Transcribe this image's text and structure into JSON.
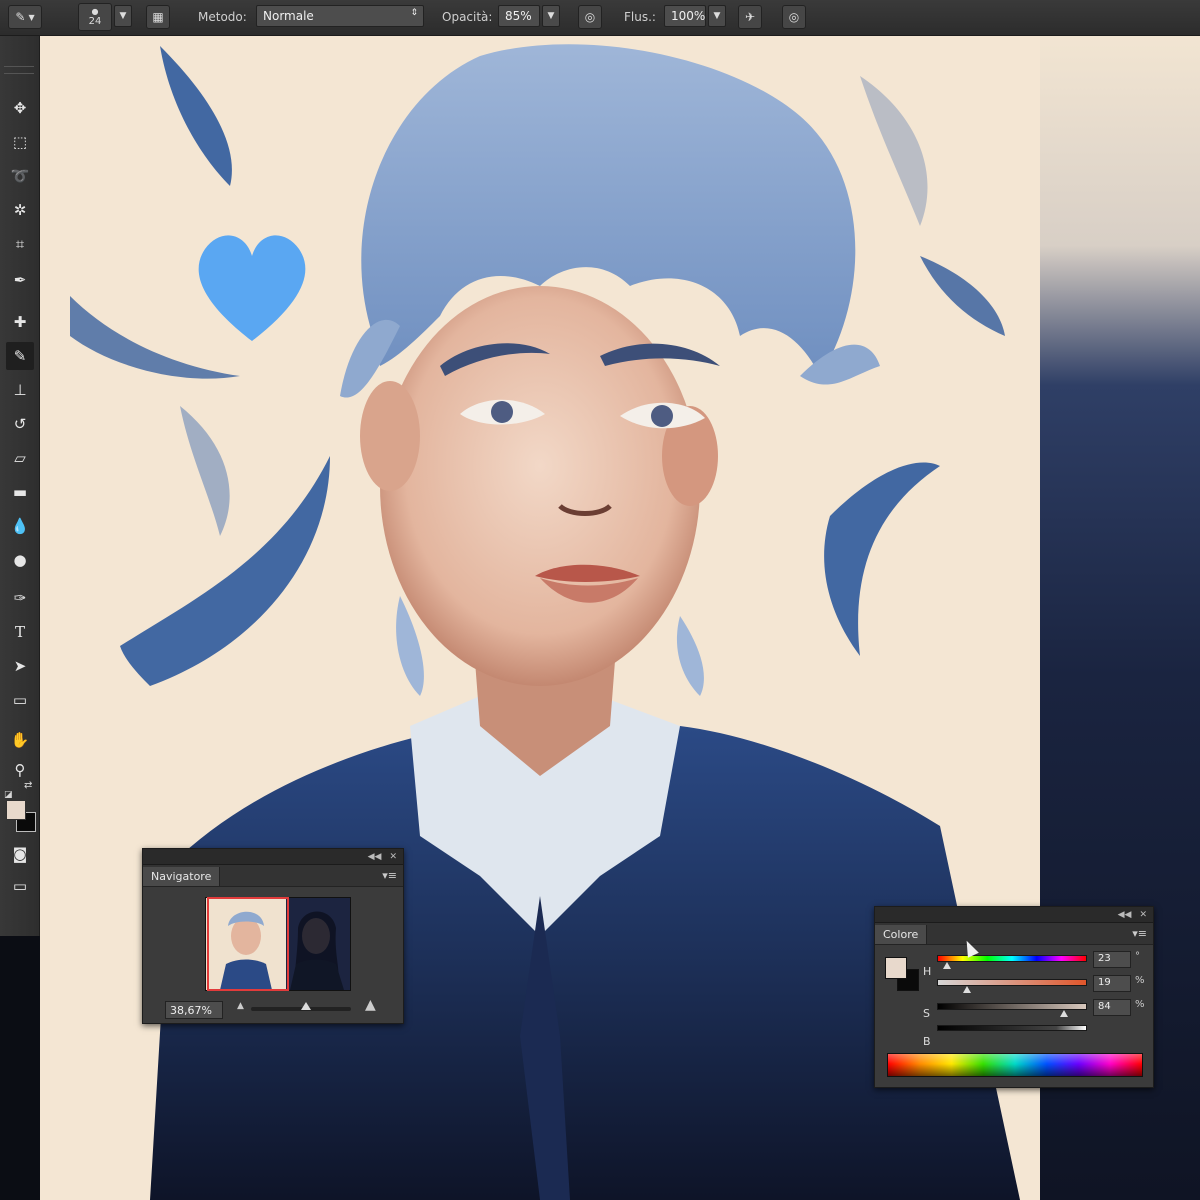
{
  "options_bar": {
    "brush_size": "24",
    "mode_label": "Metodo:",
    "mode_value": "Normale",
    "opacity_label": "Opacità:",
    "opacity_value": "85%",
    "flow_label": "Flus.:",
    "flow_value": "100%"
  },
  "tools": [
    {
      "icon": "move-icon"
    },
    {
      "icon": "marquee-icon"
    },
    {
      "icon": "lasso-icon"
    },
    {
      "icon": "magic-wand-icon"
    },
    {
      "icon": "crop-icon"
    },
    {
      "icon": "eyedropper-icon"
    },
    {
      "icon": "healing-brush-icon"
    },
    {
      "icon": "brush-icon",
      "active": true
    },
    {
      "icon": "clone-stamp-icon"
    },
    {
      "icon": "history-brush-icon"
    },
    {
      "icon": "eraser-icon"
    },
    {
      "icon": "gradient-icon"
    },
    {
      "icon": "blur-icon"
    },
    {
      "icon": "dodge-icon"
    },
    {
      "icon": "pen-icon"
    },
    {
      "icon": "type-icon"
    },
    {
      "icon": "path-selection-icon"
    },
    {
      "icon": "rectangle-shape-icon"
    },
    {
      "icon": "hand-icon"
    },
    {
      "icon": "zoom-icon"
    },
    {
      "icon": "quick-mask-icon"
    },
    {
      "icon": "screen-mode-icon"
    }
  ],
  "colors": {
    "foreground": "#e8d9cc",
    "background": "#0a0a0a",
    "heart": "#5aa7f2",
    "hair": "#8fa9cf",
    "jacket": "#1e3563",
    "accent_stroke": "#2f5a9c"
  },
  "navigator": {
    "title": "Navigatore",
    "zoom": "38,67%",
    "slider_fraction": 0.55
  },
  "color_panel": {
    "title": "Colore",
    "rows": [
      {
        "label": "H",
        "value": "23",
        "unit": "°",
        "fraction": 0.06
      },
      {
        "label": "S",
        "value": "19",
        "unit": "%",
        "fraction": 0.19
      },
      {
        "label": "B",
        "value": "84",
        "unit": "%",
        "fraction": 0.84
      }
    ]
  }
}
